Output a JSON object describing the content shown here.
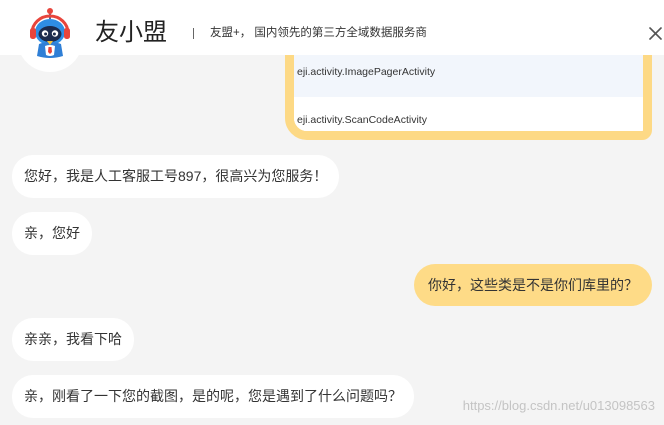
{
  "header": {
    "title": "友小盟",
    "subtitle": "友盟+， 国内领先的第三方全域数据服务商"
  },
  "icons": {
    "avatar": "robot-mascot-icon",
    "close": "close-icon"
  },
  "colors": {
    "background": "#f4f4f4",
    "header": "#ffffff",
    "agent_bubble": "#ffffff",
    "user_bubble": "#fedb87",
    "screenshot_border": "#fdd985",
    "screenshot_highlight_row": "#f2f6fc",
    "text": "#333333",
    "watermark": "#c4c4c4"
  },
  "chat": {
    "screenshot_message": {
      "outgoing": true,
      "lines": [
        "eji.activity.ImagePagerActivity",
        "eji.activity.ScanCodeActivity"
      ]
    },
    "messages": [
      {
        "outgoing": false,
        "text": "您好，我是人工客服工号897，很高兴为您服务！"
      },
      {
        "outgoing": false,
        "text": "亲，您好"
      },
      {
        "outgoing": true,
        "text": "你好，这些类是不是你们库里的？"
      },
      {
        "outgoing": false,
        "text": "亲亲，我看下哈"
      },
      {
        "outgoing": false,
        "text": "亲，刚看了一下您的截图，是的呢，您是遇到了什么问题吗？"
      }
    ]
  },
  "watermark": "https://blog.csdn.net/u013098563"
}
